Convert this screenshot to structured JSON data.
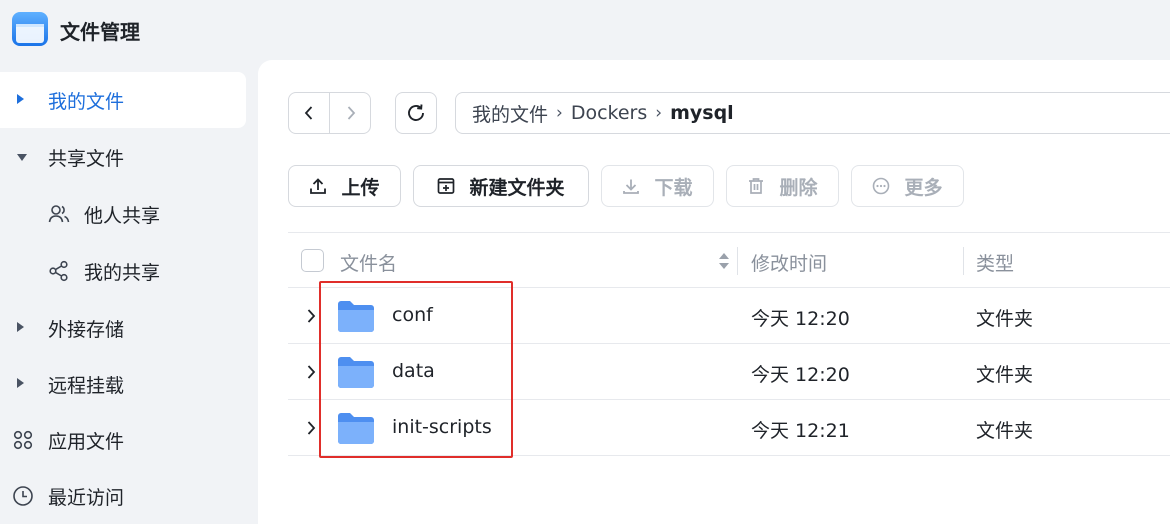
{
  "app": {
    "title": "文件管理"
  },
  "sidebar": {
    "items": [
      {
        "label": "我的文件",
        "icon": "caret-right-icon",
        "active": true
      },
      {
        "label": "共享文件",
        "icon": "caret-down-icon",
        "active": false
      },
      {
        "label": "他人共享",
        "icon": "users-icon",
        "active": false
      },
      {
        "label": "我的共享",
        "icon": "share-icon",
        "active": false
      },
      {
        "label": "外接存储",
        "icon": "caret-right-icon",
        "active": false
      },
      {
        "label": "远程挂载",
        "icon": "caret-right-icon",
        "active": false
      },
      {
        "label": "应用文件",
        "icon": "apps-grid-icon",
        "active": false
      },
      {
        "label": "最近访问",
        "icon": "clock-icon",
        "active": false
      }
    ]
  },
  "breadcrumb": {
    "parts": [
      "我的文件",
      "Dockers"
    ],
    "current": "mysql",
    "separator": "›"
  },
  "toolbar": {
    "upload": "上传",
    "new_folder": "新建文件夹",
    "download": "下载",
    "delete": "删除",
    "more": "更多"
  },
  "table": {
    "columns": {
      "name": "文件名",
      "modified": "修改时间",
      "type": "类型"
    },
    "rows": [
      {
        "name": "conf",
        "modified": "今天 12:20",
        "type": "文件夹"
      },
      {
        "name": "data",
        "modified": "今天 12:20",
        "type": "文件夹"
      },
      {
        "name": "init-scripts",
        "modified": "今天 12:21",
        "type": "文件夹"
      }
    ]
  },
  "colors": {
    "accent": "#1e6fdc",
    "highlight": "#e02e2a",
    "folder": "#5b9cf6",
    "sidebar_bg": "#f1f3f6",
    "disabled_text": "#a9afb8"
  }
}
